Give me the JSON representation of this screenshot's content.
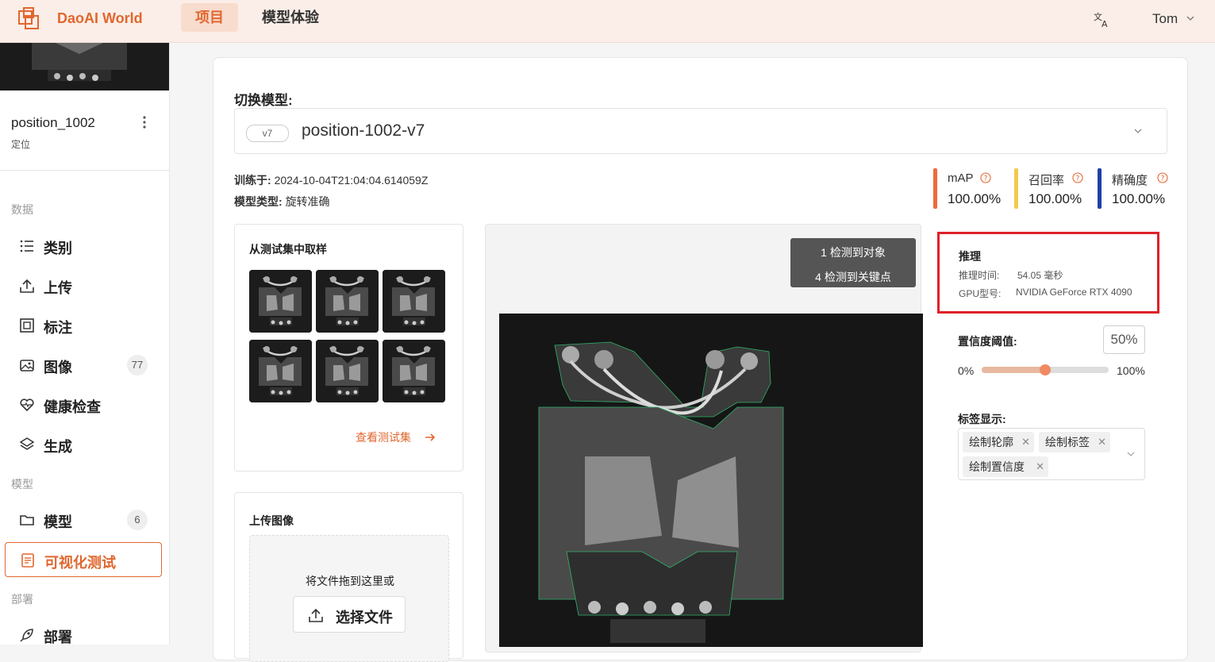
{
  "app": {
    "brand": "DaoAI World",
    "nav_tabs": [
      {
        "label": "项目",
        "active": true
      },
      {
        "label": "模型体验",
        "active": false
      }
    ],
    "user": "Tom",
    "accent_color": "#e0672f"
  },
  "sidebar": {
    "project_name": "position_1002",
    "project_type": "定位",
    "sections": {
      "data": "数据",
      "model": "模型",
      "deploy": "部署"
    },
    "items": [
      {
        "label": "类别",
        "icon": "list-icon"
      },
      {
        "label": "上传",
        "icon": "upload-icon"
      },
      {
        "label": "标注",
        "icon": "annotate-icon"
      },
      {
        "label": "图像",
        "icon": "image-icon",
        "count": "77"
      },
      {
        "label": "健康检查",
        "icon": "heart-icon"
      },
      {
        "label": "生成",
        "icon": "layers-icon"
      },
      {
        "label": "模型",
        "icon": "folder-icon",
        "count": "6"
      },
      {
        "label": "可视化测试",
        "icon": "document-icon",
        "active": true
      },
      {
        "label": "部署",
        "icon": "rocket-icon"
      }
    ]
  },
  "main": {
    "switch_model_label": "切换模型:",
    "model": {
      "version": "v7",
      "name": "position-1002-v7"
    },
    "trained_at_label": "训练于:",
    "trained_at": "2024-10-04T21:04:04.614059Z",
    "model_type_label": "模型类型:",
    "model_type": "旋转准确",
    "metrics": [
      {
        "name": "mAP",
        "value": "100.00%",
        "color": "#ec6a3c"
      },
      {
        "name": "召回率",
        "value": "100.00%",
        "color": "#f2c94c"
      },
      {
        "name": "精确度",
        "value": "100.00%",
        "color": "#1f3fa8"
      }
    ],
    "sample_panel": {
      "title": "从测试集中取样",
      "view_link": "查看测试集"
    },
    "upload_panel": {
      "title": "上传图像",
      "drop_text": "将文件拖到这里或",
      "choose_button": "选择文件"
    },
    "detection": {
      "objects": "1 检测到对象",
      "keypoints": "4 检测到关键点"
    },
    "inference": {
      "title": "推理",
      "time_label": "推理时间:",
      "time_value": "54.05 毫秒",
      "gpu_label": "GPU型号:",
      "gpu_value": "NVIDIA GeForce RTX 4090"
    },
    "confidence": {
      "label": "置信度阈值:",
      "value": "50%",
      "fraction": 0.5,
      "min": "0%",
      "max": "100%"
    },
    "tags": {
      "label": "标签显示:",
      "selected": [
        "绘制轮廓",
        "绘制标签",
        "绘制置信度"
      ]
    }
  }
}
